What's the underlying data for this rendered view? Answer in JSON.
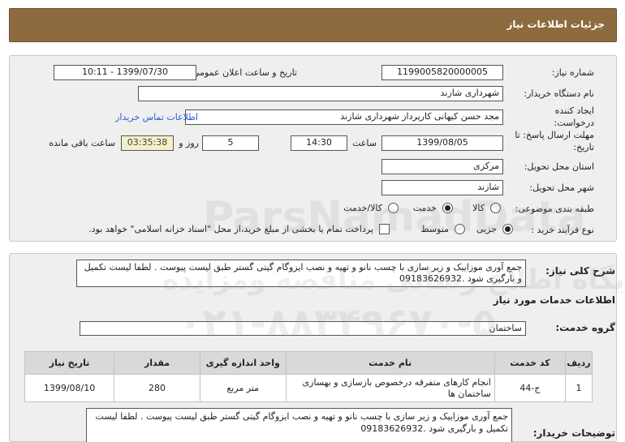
{
  "page_title": "جزئیات اطلاعات نیاز",
  "labels": {
    "need_number": "شماره نیاز:",
    "announce_datetime": "تاریخ و ساعت اعلان عمومی:",
    "buyer_org": "نام دستگاه خریدار:",
    "requester": "ایجاد کننده درخواست:",
    "deadline": "مهلت ارسال پاسخ: تا تاریخ:",
    "time": "ساعت",
    "days": "روز و",
    "remaining": "ساعت باقی مانده",
    "province": "استان محل تحویل:",
    "city": "شهر محل تحویل:",
    "category": "طبقه بندی موضوعی:",
    "purchase_type": "نوع فرآیند خرید :",
    "description": "شرح کلی نیاز:",
    "services_info": "اطلاعات خدمات مورد نیاز",
    "service_group": "گروه خدمت:",
    "buyer_notes": "توضیحات خریدار:"
  },
  "values": {
    "need_number": "1199005820000005",
    "announce_datetime": "1399/07/30 - 10:11",
    "buyer_org": "شهرداری شازند",
    "requester": "مجد حسن کیهانی کارپرداز شهرداری شازند",
    "contact_link": "اطلاعات تماس خریدار",
    "deadline_date": "1399/08/05",
    "deadline_time": "14:30",
    "days": "5",
    "remaining_time": "03:35:38",
    "province": "مرکزی",
    "city": "شازند",
    "description": "جمع آوری موزاییک و زیر سازی با چسب نانو و تهیه و نصب ایزوگام گیتی گستر طبق لیست پیوست . لطفا لیست تکمیل و بارگیری شود .09183626932",
    "service_group": "ساختمان",
    "buyer_notes": "جمع آوری موزاییک و زیر سازی با چسب نانو و تهیه و نصب ایزوگام گیتی گستر طبق لیست پیوست . لطفا لیست تکمیل و بارگیری شود .09183626932"
  },
  "category_options": {
    "goods": "کالا",
    "service": "خدمت",
    "goods_service": "کالا/خدمت",
    "selected": "خدمت"
  },
  "purchase_options": {
    "minor": "جزیی",
    "medium": "متوسط",
    "selected": "جزیی",
    "treasury_note": "پرداخت تمام یا بخشی از مبلغ خرید،از محل \"اسناد خزانه اسلامی\" خواهد بود."
  },
  "table": {
    "headers": [
      "ردیف",
      "کد خدمت",
      "نام خدمت",
      "واحد اندازه گیری",
      "مقدار",
      "تاریخ نیاز"
    ],
    "rows": [
      [
        "1",
        "ج-44",
        "انجام کارهای متفرقه درخصوص بازسازی و بهسازی ساختمان ها",
        "متر مربع",
        "280",
        "1399/08/10"
      ]
    ]
  },
  "watermark": {
    "line1": "ParsNamadData",
    "line2": "پایگاه اطلاع رسانی مناقصه ومزایده",
    "line3": "۰۲۱-۸۸۳۴۹۶۷۰-۵"
  },
  "colors": {
    "header_bg": "#8e6b3e",
    "panel_bg": "#efefef",
    "link": "#2a5bd6",
    "timer_bg": "#f2f0c8",
    "table_header_bg": "#d9d9d9"
  }
}
